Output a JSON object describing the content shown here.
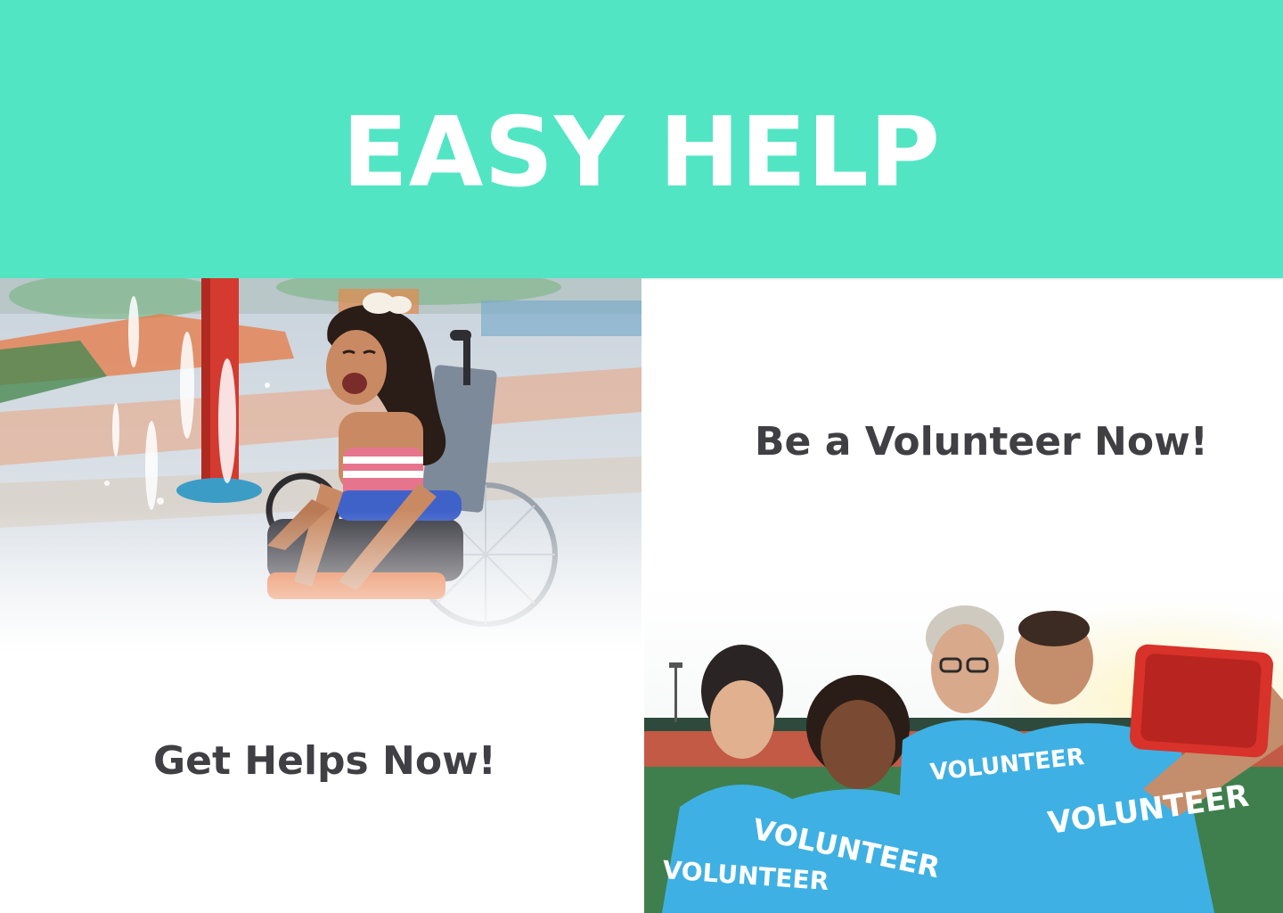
{
  "header": {
    "title": "EASY HELP"
  },
  "left_panel": {
    "cta_label": "Get Helps Now!"
  },
  "right_panel": {
    "cta_label": "Be a Volunteer Now!"
  },
  "photos": {
    "volunteers": {
      "shirt_text": "VOLUNTEER"
    }
  },
  "colors": {
    "header_bg": "#52e5c3",
    "header_text": "#ffffff",
    "cta_text": "#3f3f44",
    "shirt_blue": "#3fb0e3"
  }
}
